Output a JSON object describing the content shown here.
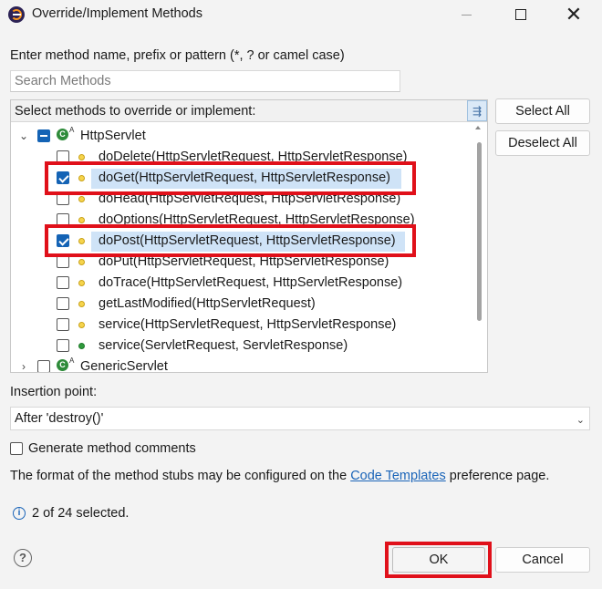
{
  "window": {
    "title": "Override/Implement Methods",
    "icon": "eclipse-icon"
  },
  "prompt": {
    "label": "Enter method name, prefix or pattern (*, ? or camel case)",
    "search_placeholder": "Search Methods",
    "search_value": ""
  },
  "tree": {
    "header_label": "Select methods to override or implement:",
    "header_icon": "flat-hierarchy-toggle-icon",
    "classes": [
      {
        "name": "HttpServlet",
        "expanded": true,
        "check_state": "mixed",
        "icon": "abstract-class-icon",
        "methods": [
          {
            "label": "doDelete(HttpServletRequest, HttpServletResponse)",
            "checked": false,
            "visibility": "protected"
          },
          {
            "label": "doGet(HttpServletRequest, HttpServletResponse)",
            "checked": true,
            "visibility": "protected"
          },
          {
            "label": "doHead(HttpServletRequest, HttpServletResponse)",
            "checked": false,
            "visibility": "protected"
          },
          {
            "label": "doOptions(HttpServletRequest, HttpServletResponse)",
            "checked": false,
            "visibility": "protected"
          },
          {
            "label": "doPost(HttpServletRequest, HttpServletResponse)",
            "checked": true,
            "visibility": "protected"
          },
          {
            "label": "doPut(HttpServletRequest, HttpServletResponse)",
            "checked": false,
            "visibility": "protected"
          },
          {
            "label": "doTrace(HttpServletRequest, HttpServletResponse)",
            "checked": false,
            "visibility": "protected"
          },
          {
            "label": "getLastModified(HttpServletRequest)",
            "checked": false,
            "visibility": "protected"
          },
          {
            "label": "service(HttpServletRequest, HttpServletResponse)",
            "checked": false,
            "visibility": "protected"
          },
          {
            "label": "service(ServletRequest, ServletResponse)",
            "checked": false,
            "visibility": "public"
          }
        ]
      },
      {
        "name": "GenericServlet",
        "expanded": false,
        "check_state": "unchecked",
        "icon": "abstract-class-icon"
      }
    ]
  },
  "side_buttons": {
    "select_all": "Select All",
    "deselect_all": "Deselect All"
  },
  "insertion": {
    "label": "Insertion point:",
    "value": "After 'destroy()'"
  },
  "generate_comments": {
    "label": "Generate method comments",
    "checked": false
  },
  "info": {
    "before": "The format of the method stubs may be configured on the ",
    "link": "Code Templates",
    "after": " preference page."
  },
  "status": {
    "text": "2 of 24 selected."
  },
  "footer": {
    "ok": "OK",
    "cancel": "Cancel"
  },
  "colors": {
    "highlight": "#e0101a",
    "accent": "#1463b5",
    "selection": "#cfe3f7",
    "link": "#1a64b8"
  }
}
